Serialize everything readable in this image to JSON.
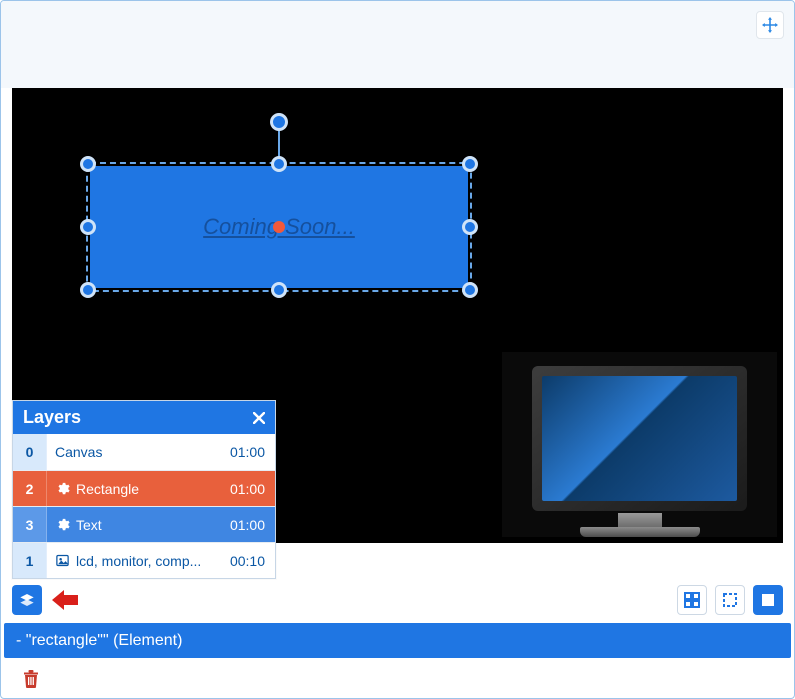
{
  "layers_panel": {
    "title": "Layers",
    "rows": [
      {
        "index": "0",
        "label": "Canvas",
        "time": "01:00"
      },
      {
        "index": "2",
        "label": "Rectangle",
        "time": "01:00"
      },
      {
        "index": "3",
        "label": "Text",
        "time": "01:00"
      },
      {
        "index": "1",
        "label": "lcd, monitor, comp...",
        "time": "00:10"
      }
    ]
  },
  "stage": {
    "selected_text": "Coming Soon..."
  },
  "status_bar": {
    "text": "- \"rectangle\"\" (Element)"
  }
}
